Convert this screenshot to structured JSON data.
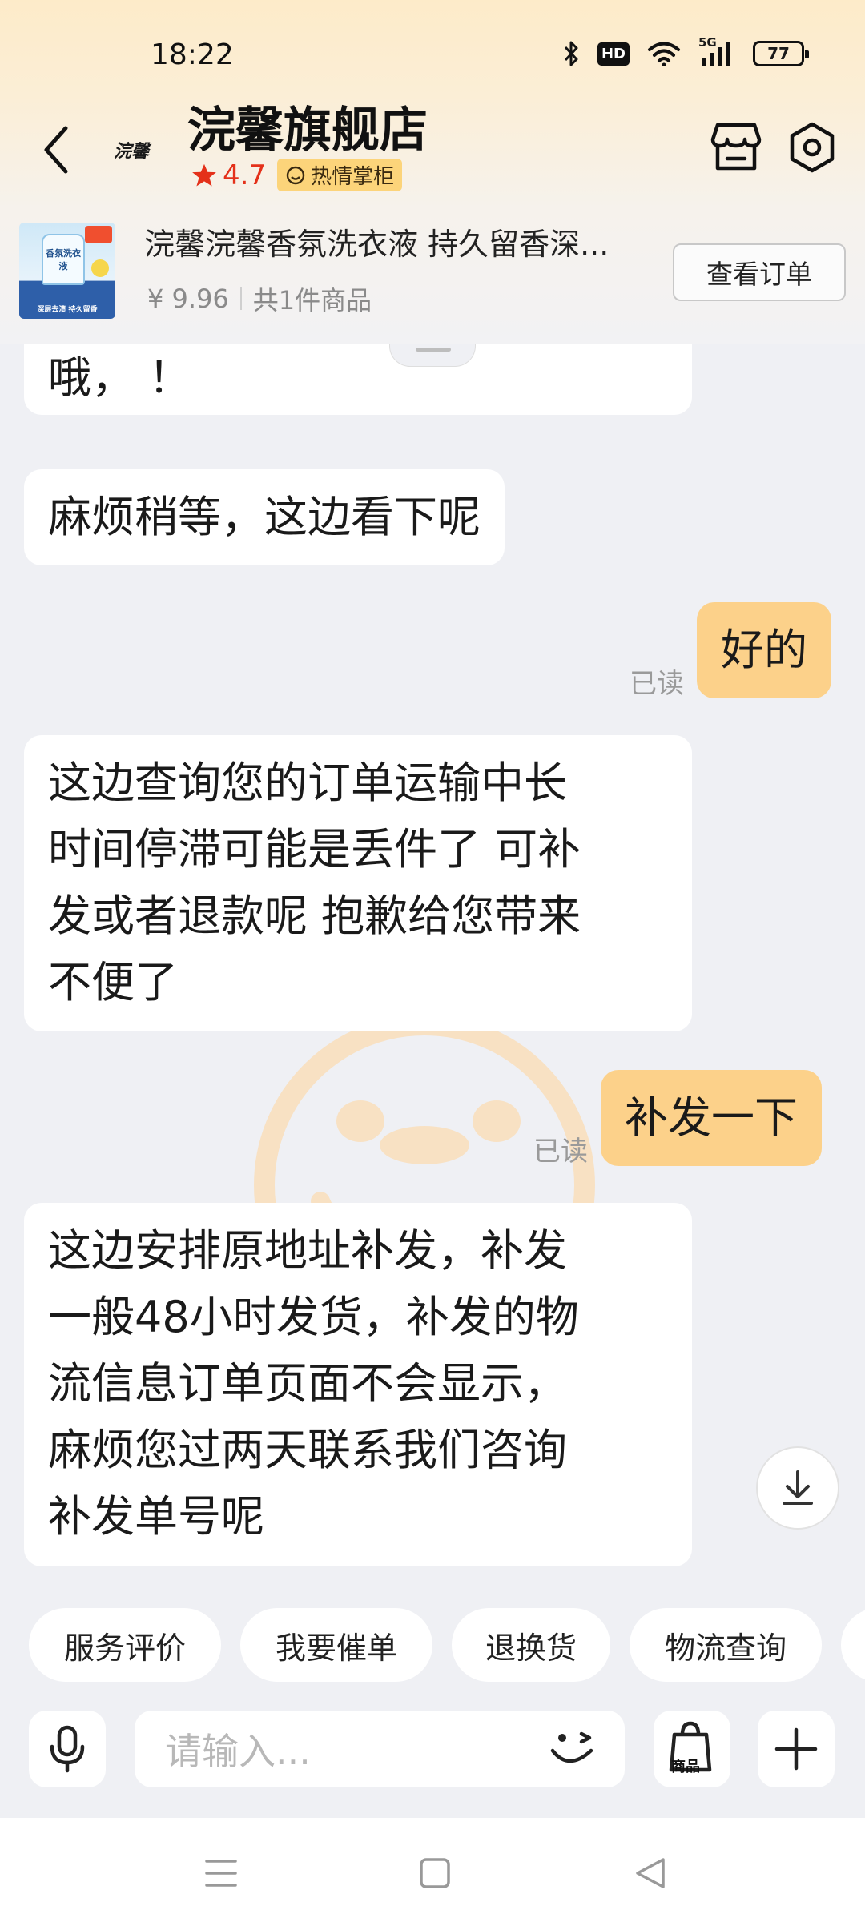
{
  "status_bar": {
    "time": "18:22",
    "hd_label": "HD",
    "network_label": "5G",
    "battery": "77"
  },
  "header": {
    "logo_text": "浣馨",
    "shop_name": "浣馨旗舰店",
    "rating": "4.7",
    "badge": "热情掌柜"
  },
  "order": {
    "product_title": "浣馨浣馨香氛洗衣液 持久留香深...",
    "price": "¥ 9.96",
    "count": "共1件商品",
    "view_order_label": "查看订单",
    "thumb_label": "香氛洗衣液",
    "thumb_strip": "深层去渍 持久留香"
  },
  "messages": [
    {
      "side": "left",
      "text": "哦，  ！"
    },
    {
      "side": "left",
      "text": "麻烦稍等，这边看下呢"
    },
    {
      "side": "right",
      "text": "好的",
      "status": "已读"
    },
    {
      "side": "left",
      "lines": [
        "这边查询您的订单运输中长",
        "时间停滞可能是丢件了 可补",
        "发或者退款呢 抱歉给您带来",
        "不便了"
      ]
    },
    {
      "side": "right",
      "text": "补发一下",
      "status": "已读"
    },
    {
      "side": "left",
      "lines": [
        "这边安排原地址补发，补发",
        "一般48小时发货，补发的物",
        "流信息订单页面不会显示，",
        "麻烦您过两天联系我们咨询",
        "补发单号呢"
      ]
    }
  ],
  "quick_actions": [
    "服务评价",
    "我要催单",
    "退换货",
    "物流查询"
  ],
  "input": {
    "placeholder": "请输入...",
    "goods_label": "商品"
  },
  "colors": {
    "accent": "#fcd18a",
    "rating_red": "#e4311a",
    "badge_yellow": "#fcd47a",
    "background": "#eff0f4"
  },
  "icons": {
    "back": "chevron-left-icon",
    "store": "store-icon",
    "settings": "settings-hexagon-icon",
    "scroll": "arrow-down-icon",
    "mic": "mic-icon",
    "emoji": "emoji-icon",
    "goods": "shopping-bag-icon",
    "plus": "plus-icon"
  }
}
